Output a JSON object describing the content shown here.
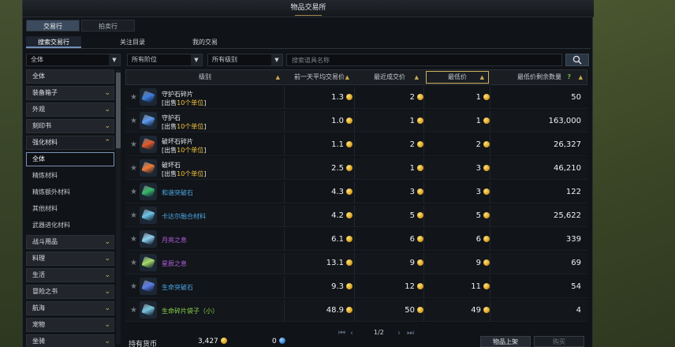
{
  "window_title": "物品交易所",
  "top_tabs": [
    {
      "label": "交易行",
      "active": true
    },
    {
      "label": "拍卖行",
      "active": false
    }
  ],
  "sub_tabs": [
    {
      "label": "搜索交易行",
      "active": true
    },
    {
      "label": "关注目录",
      "active": false
    },
    {
      "label": "我的交易",
      "active": false
    }
  ],
  "filters": {
    "category_value": "全体",
    "tier_value": "所有阶位",
    "grade_value": "所有级别",
    "search_placeholder": "搜索道具名称"
  },
  "sidebar": {
    "items": [
      {
        "label": "全体",
        "kind": "category"
      },
      {
        "label": "装备箱子",
        "kind": "category",
        "chevron": "down"
      },
      {
        "label": "外观",
        "kind": "category",
        "chevron": "down"
      },
      {
        "label": "刻印书",
        "kind": "category",
        "chevron": "down"
      },
      {
        "label": "强化材料",
        "kind": "category",
        "chevron": "up",
        "open": true
      },
      {
        "label": "全体",
        "kind": "sub",
        "selected": true
      },
      {
        "label": "精炼材料",
        "kind": "sub"
      },
      {
        "label": "精炼额外材料",
        "kind": "sub"
      },
      {
        "label": "其他材料",
        "kind": "sub"
      },
      {
        "label": "武器进化材料",
        "kind": "sub"
      },
      {
        "label": "战斗用品",
        "kind": "category",
        "chevron": "down"
      },
      {
        "label": "料理",
        "kind": "category",
        "chevron": "down"
      },
      {
        "label": "生活",
        "kind": "category",
        "chevron": "down"
      },
      {
        "label": "冒险之书",
        "kind": "category",
        "chevron": "down"
      },
      {
        "label": "航海",
        "kind": "category",
        "chevron": "down"
      },
      {
        "label": "宠物",
        "kind": "category",
        "chevron": "down"
      },
      {
        "label": "坐骑",
        "kind": "category",
        "chevron": "down"
      }
    ]
  },
  "table": {
    "headers": {
      "grade": "级别",
      "avg_price": "前一天平均交易价",
      "recent_price": "最近成交价",
      "lowest_price": "最低价",
      "lowest_count": "最低价剩余数量"
    },
    "rows": [
      {
        "name": "守护石碎片",
        "sub_prefix": "[出售",
        "sub_highlight": "10个单位",
        "sub_suffix": "]",
        "name_color": "#e6e8eb",
        "gem": "#3f7fe0",
        "avg": "1.3",
        "recent": "2",
        "lowest": "1",
        "count": "50"
      },
      {
        "name": "守护石",
        "sub_prefix": "[出售",
        "sub_highlight": "10个单位",
        "sub_suffix": "]",
        "name_color": "#e6e8eb",
        "gem": "#5f9df2",
        "avg": "1.0",
        "recent": "1",
        "lowest": "1",
        "count": "163,000"
      },
      {
        "name": "破坏石碎片",
        "sub_prefix": "[出售",
        "sub_highlight": "10个单位",
        "sub_suffix": "]",
        "name_color": "#e6e8eb",
        "gem": "#e25a2a",
        "avg": "1.1",
        "recent": "2",
        "lowest": "2",
        "count": "26,327"
      },
      {
        "name": "破坏石",
        "sub_prefix": "[出售",
        "sub_highlight": "10个单位",
        "sub_suffix": "]",
        "name_color": "#e6e8eb",
        "gem": "#f07a34",
        "avg": "2.5",
        "recent": "1",
        "lowest": "3",
        "count": "46,210"
      },
      {
        "name": "和谐突破石",
        "name_color": "#4aa6e6",
        "gem": "#39b86a",
        "avg": "4.3",
        "recent": "3",
        "lowest": "3",
        "count": "122"
      },
      {
        "name": "卡达尔融合材料",
        "name_color": "#4aa6e6",
        "gem": "#6fc3e8",
        "avg": "4.2",
        "recent": "5",
        "lowest": "5",
        "count": "25,622"
      },
      {
        "name": "月亮之息",
        "name_color": "#b25ee0",
        "gem": "#8ed1f0",
        "avg": "6.1",
        "recent": "6",
        "lowest": "6",
        "count": "339"
      },
      {
        "name": "星辰之息",
        "name_color": "#b25ee0",
        "gem": "#a6dd67",
        "avg": "13.1",
        "recent": "9",
        "lowest": "9",
        "count": "69"
      },
      {
        "name": "生命突破石",
        "name_color": "#4aa6e6",
        "gem": "#5b7de8",
        "avg": "9.3",
        "recent": "12",
        "lowest": "11",
        "count": "54"
      },
      {
        "name": "生命碎片袋子（小）",
        "name_color": "#89d14a",
        "gem": "#7ac8e0",
        "avg": "48.9",
        "recent": "50",
        "lowest": "49",
        "count": "4"
      }
    ]
  },
  "pagination": {
    "current": "1/2"
  },
  "footer": {
    "currency_label": "持有货币",
    "gold": "3,427",
    "crystal": "0",
    "list_button": "物品上架",
    "buy_button": "购买"
  },
  "colors": {
    "accent_gold": "#cfb060",
    "tab_active": "#3b4a5d"
  }
}
